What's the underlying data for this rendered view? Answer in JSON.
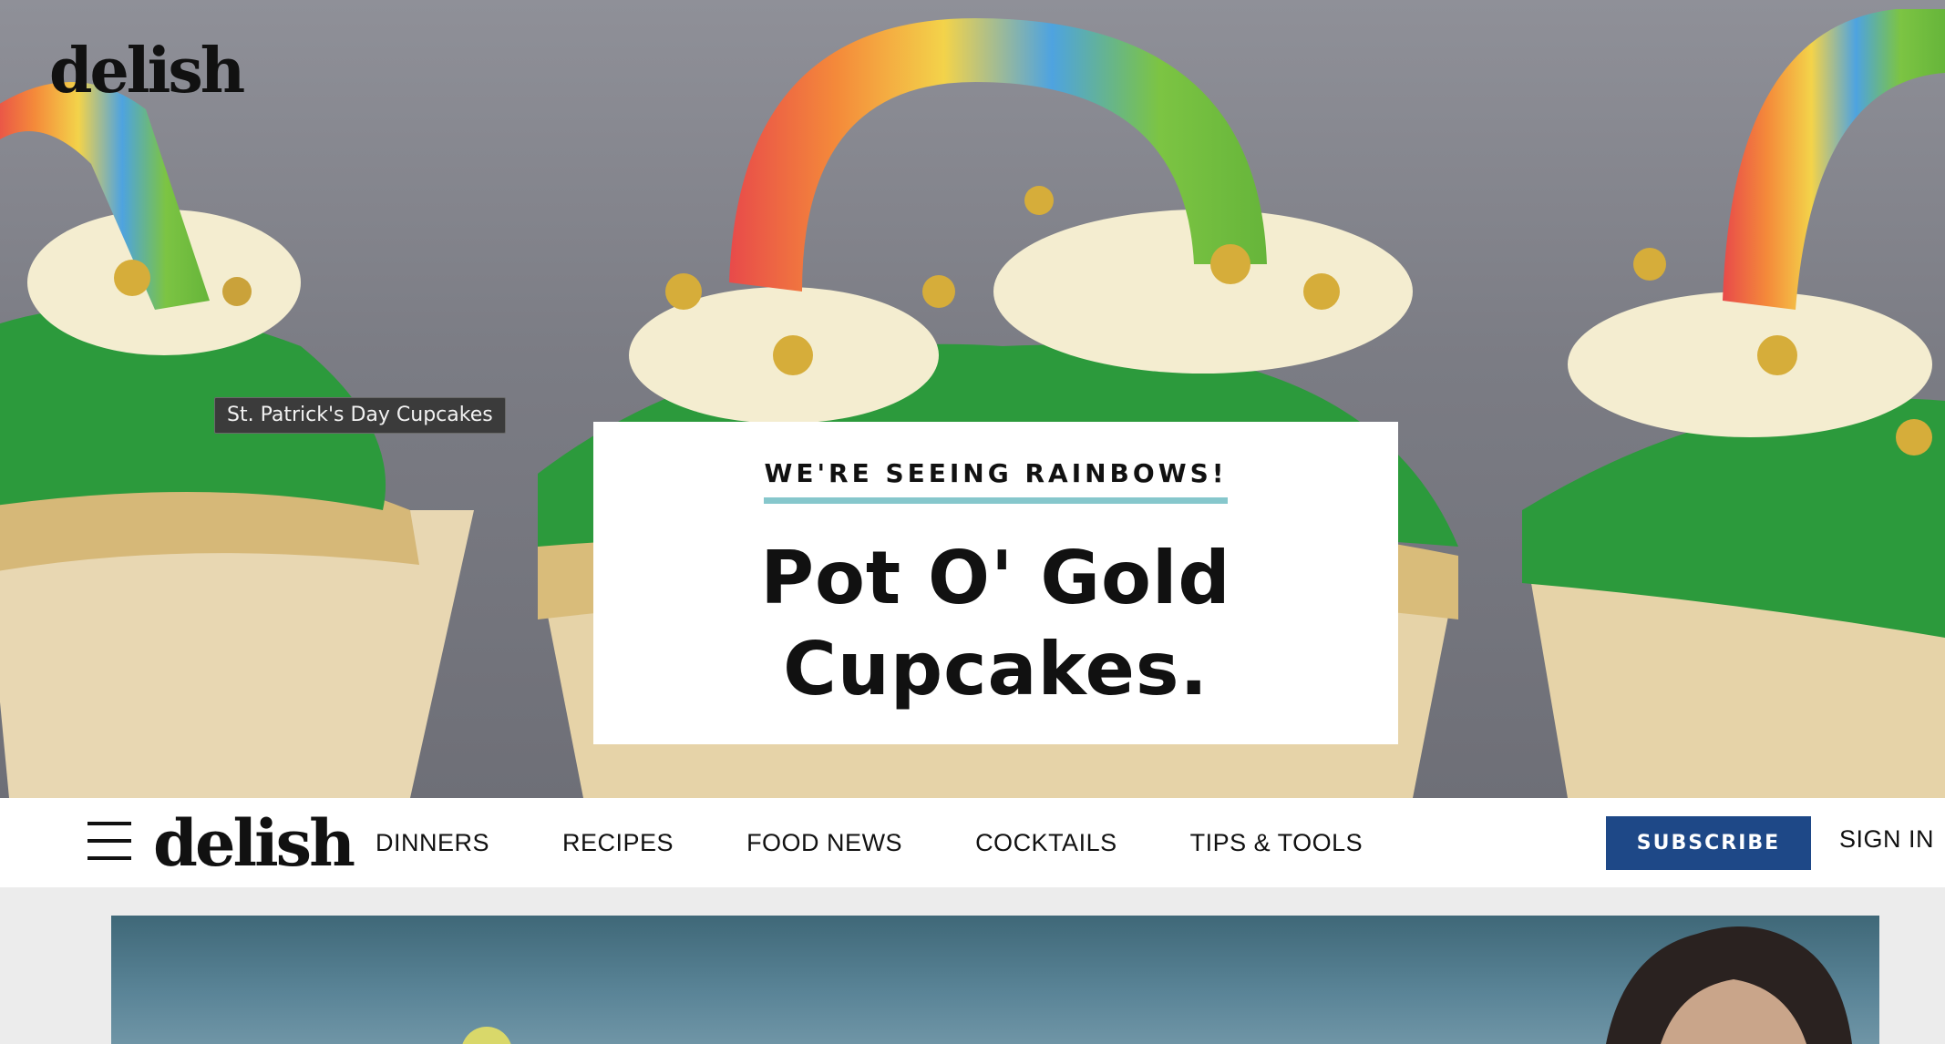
{
  "hero": {
    "logo": "delish",
    "image_tooltip": "St. Patrick's Day Cupcakes",
    "kicker": "WE'RE SEEING RAINBOWS!",
    "headline": "Pot O' Gold Cupcakes."
  },
  "nav": {
    "logo": "delish",
    "menu_icon": "hamburger-menu-icon",
    "links": [
      "DINNERS",
      "RECIPES",
      "FOOD NEWS",
      "COCKTAILS",
      "TIPS & TOOLS"
    ],
    "subscribe_label": "SUBSCRIBE",
    "signin_label": "SIGN IN"
  },
  "colors": {
    "subscribe_bg": "#1e4887",
    "kicker_underline": "#86c7cc",
    "frosting_green": "#2c9a3c"
  }
}
